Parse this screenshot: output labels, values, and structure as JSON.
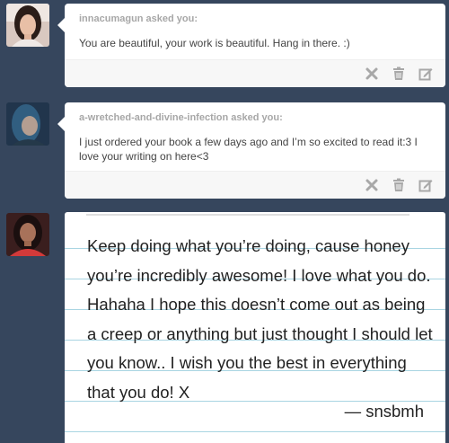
{
  "posts": [
    {
      "asker": "innacumagun asked you:",
      "question": "You are beautiful, your work is beautiful. Hang in there. :)"
    },
    {
      "asker": "a-wretched-and-divine-infection asked you:",
      "question": "I just ordered your book a few days ago and I’m so excited to read it:3 I love your writing on here<3"
    }
  ],
  "note": {
    "text": "Keep doing what you’re doing, cause honey you’re incredibly awesome! I love what you do. Hahaha I hope this doesn’t come out as being a creep or anything but just thought I should let you know.. I wish you the best in everything that you do! X",
    "signature": "— snsbmh"
  },
  "actions": {
    "icons": [
      "close-icon",
      "trash-icon",
      "edit-icon"
    ]
  },
  "colors": {
    "background": "#36465d",
    "card": "#ffffff",
    "icon": "#a8a8a8",
    "paper_line": "#a9d5e2"
  }
}
